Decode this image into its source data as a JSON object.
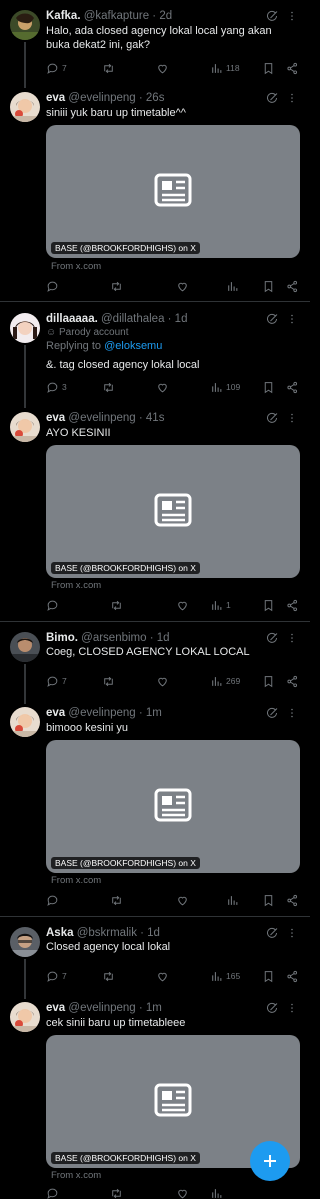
{
  "card": {
    "label": "BASE (@BROOKFORDHIGHS) on X",
    "from": "From x.com"
  },
  "threads": [
    {
      "parent": {
        "name": "Kafka.",
        "handle": "@kafkapture · 2d",
        "text": "Halo, ada closed agency lokal local yang akan buka dekat2 ini, gak?",
        "replies": "7",
        "views": "118"
      },
      "reply": {
        "name": "eva",
        "handle": "@evelinpeng · 26s",
        "text": "siniii yuk baru up timetable^^"
      }
    },
    {
      "parent": {
        "name": "dillaaaaa.",
        "handle": "@dillathalea · 1d",
        "parody": "Parody account",
        "replying_to_prefix": "Replying to ",
        "replying_to": "@eloksemu",
        "text": "&. tag closed agency lokal local",
        "replies": "3",
        "views": "109"
      },
      "reply": {
        "name": "eva",
        "handle": "@evelinpeng · 41s",
        "text": "AYO KESINII",
        "views": "1"
      }
    },
    {
      "parent": {
        "name": "Bimo.",
        "handle": "@arsenbimo · 1d",
        "text": "Coeg, CLOSED AGENCY LOKAL LOCAL",
        "replies": "7",
        "views": "269"
      },
      "reply": {
        "name": "eva",
        "handle": "@evelinpeng · 1m",
        "text": "bimooo kesini yu"
      }
    },
    {
      "parent": {
        "name": "Aska",
        "handle": "@bskrmalik · 1d",
        "text": "Closed agency local lokal",
        "replies": "7",
        "views": "165"
      },
      "reply": {
        "name": "eva",
        "handle": "@evelinpeng · 1m",
        "text": "cek sinii baru up timetableee"
      }
    }
  ]
}
